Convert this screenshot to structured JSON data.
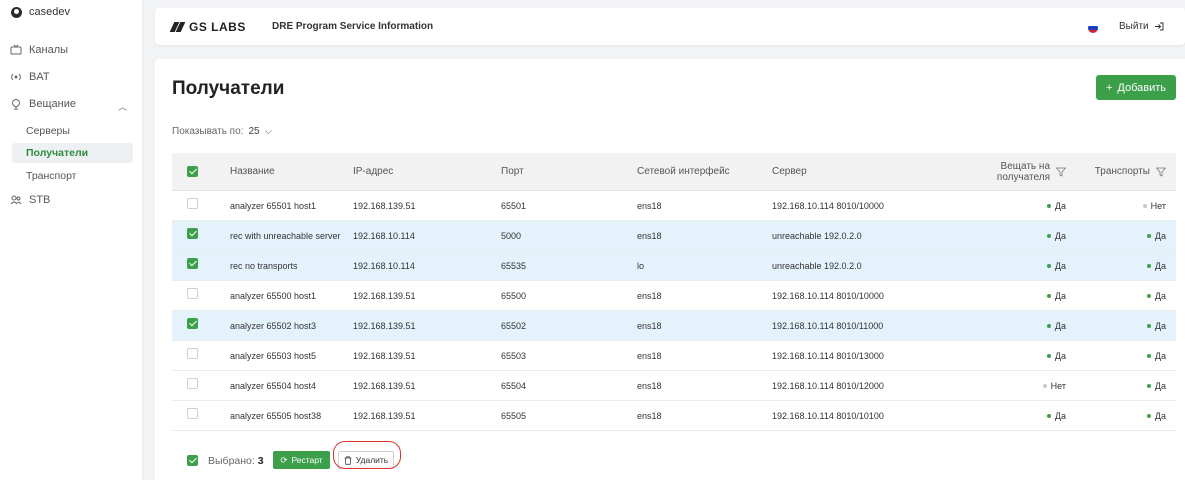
{
  "sidebar": {
    "user": "casedev",
    "items": [
      {
        "label": "Каналы"
      },
      {
        "label": "BAT"
      },
      {
        "label": "Вещание"
      },
      {
        "label": "STB"
      }
    ],
    "sub_items": [
      {
        "label": "Серверы"
      },
      {
        "label": "Получатели"
      },
      {
        "label": "Транспорт"
      }
    ]
  },
  "header": {
    "logo": "GS LABS",
    "title": "DRE Program Service Information",
    "logout": "Выйти"
  },
  "page": {
    "title": "Получатели",
    "add_label": "Добавить",
    "show_by_label": "Показывать по:",
    "show_by_value": "25"
  },
  "table": {
    "columns": {
      "name": "Название",
      "ip": "IP-адрес",
      "port": "Порт",
      "iface": "Сетевой интерфейс",
      "server": "Сервер",
      "bcast_1": "Вещать на",
      "bcast_2": "получателя",
      "transports": "Транспорты"
    },
    "rows": [
      {
        "name": "analyzer 65501 host1",
        "ip": "192.168.139.51",
        "port": "65501",
        "iface": "ens18",
        "server": "192.168.10.114 8010/10000",
        "bcast": "Да",
        "trans": "Нет",
        "selected": false
      },
      {
        "name": "rec with unreachable server",
        "ip": "192.168.10.114",
        "port": "5000",
        "iface": "ens18",
        "server": "unreachable 192.0.2.0",
        "bcast": "Да",
        "trans": "Да",
        "selected": true
      },
      {
        "name": "rec no transports",
        "ip": "192.168.10.114",
        "port": "65535",
        "iface": "lo",
        "server": "unreachable 192.0.2.0",
        "bcast": "Да",
        "trans": "Да",
        "selected": true
      },
      {
        "name": "analyzer 65500 host1",
        "ip": "192.168.139.51",
        "port": "65500",
        "iface": "ens18",
        "server": "192.168.10.114 8010/10000",
        "bcast": "Да",
        "trans": "Да",
        "selected": false
      },
      {
        "name": "analyzer 65502 host3",
        "ip": "192.168.139.51",
        "port": "65502",
        "iface": "ens18",
        "server": "192.168.10.114 8010/11000",
        "bcast": "Да",
        "trans": "Да",
        "selected": true
      },
      {
        "name": "analyzer 65503 host5",
        "ip": "192.168.139.51",
        "port": "65503",
        "iface": "ens18",
        "server": "192.168.10.114 8010/13000",
        "bcast": "Да",
        "trans": "Да",
        "selected": false
      },
      {
        "name": "analyzer 65504 host4",
        "ip": "192.168.139.51",
        "port": "65504",
        "iface": "ens18",
        "server": "192.168.10.114 8010/12000",
        "bcast": "Нет",
        "trans": "Да",
        "selected": false
      },
      {
        "name": "analyzer 65505 host38",
        "ip": "192.168.139.51",
        "port": "65505",
        "iface": "ens18",
        "server": "192.168.10.114 8010/10100",
        "bcast": "Да",
        "trans": "Да",
        "selected": false
      }
    ]
  },
  "footer": {
    "selected_label": "Выбрано:",
    "selected_count": "3",
    "restart_label": "Рестарт",
    "delete_label": "Удалить"
  },
  "colors": {
    "accent": "#3ca04b",
    "selected_row": "#e4f2fc",
    "highlight": "#e0342a"
  }
}
